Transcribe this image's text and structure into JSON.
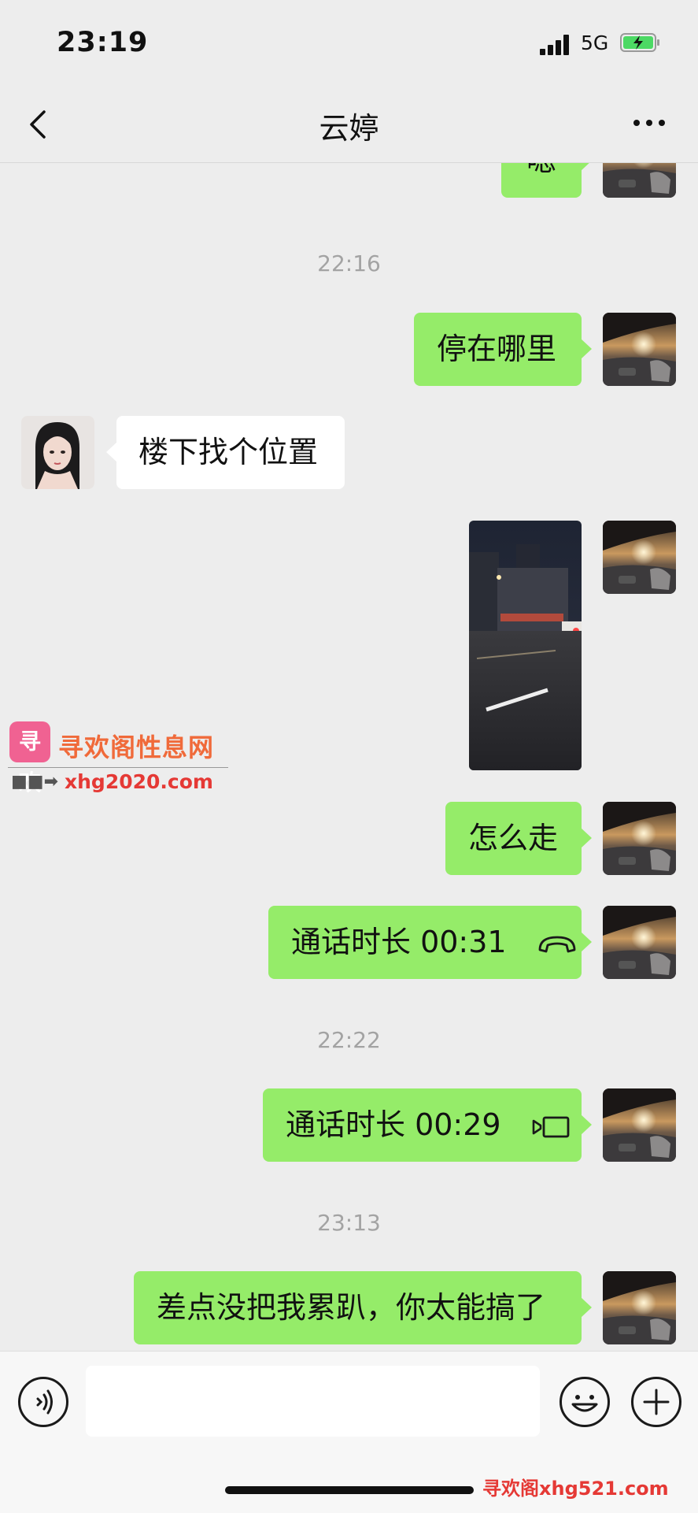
{
  "status_bar": {
    "time": "23:19",
    "network": "5G"
  },
  "nav": {
    "title": "云婷"
  },
  "messages": [
    {
      "type": "text",
      "side": "out",
      "text": "嗯"
    },
    {
      "type": "timestamp",
      "text": "22:16"
    },
    {
      "type": "text",
      "side": "out",
      "text": "停在哪里"
    },
    {
      "type": "text",
      "side": "in",
      "text": "楼下找个位置"
    },
    {
      "type": "image",
      "side": "out"
    },
    {
      "type": "text",
      "side": "out",
      "text": "怎么走"
    },
    {
      "type": "voice_call",
      "side": "out",
      "text": "通话时长 00:31",
      "icon": "phone-icon"
    },
    {
      "type": "timestamp",
      "text": "22:22"
    },
    {
      "type": "video_call",
      "side": "out",
      "text": "通话时长 00:29",
      "icon": "video-call-icon"
    },
    {
      "type": "timestamp",
      "text": "23:13"
    },
    {
      "type": "text",
      "side": "out",
      "text": "差点没把我累趴，你太能搞了"
    }
  ],
  "watermark": {
    "logo": "寻欢",
    "name": "寻欢阁性息网",
    "arrow": "■■➡",
    "url": "xhg2020.com",
    "bottom": "寻欢阁xhg521.com"
  },
  "input_bar": {
    "placeholder": ""
  },
  "colors": {
    "outgoing_bubble": "#95ec69",
    "incoming_bubble": "#ffffff",
    "background": "#ededed"
  }
}
